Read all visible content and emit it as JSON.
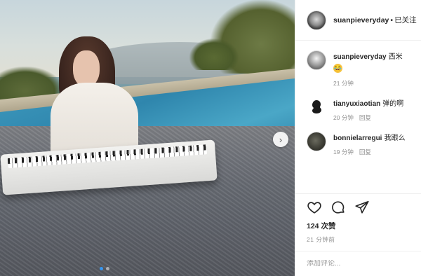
{
  "header": {
    "username": "suanpieveryday",
    "separator": "•",
    "follow_status": "已关注"
  },
  "comments": [
    {
      "username": "suanpieveryday",
      "text": "西米",
      "emoji": "😂",
      "time": "21 分钟",
      "reply": ""
    },
    {
      "username": "tianyuxiaotian",
      "text": "弹的啊",
      "time": "20 分钟",
      "reply": "回复"
    },
    {
      "username": "bonnielarregui",
      "text": "我跟么",
      "time": "19 分钟",
      "reply": "回复"
    }
  ],
  "actions": {
    "like_icon": "heart-icon",
    "comment_icon": "comment-icon",
    "share_icon": "share-icon"
  },
  "likes": "124 次赞",
  "post_time": "21 分钟前",
  "add_comment": {
    "placeholder": "添加评论..."
  },
  "media": {
    "next_arrow": "›",
    "dot_count": 2,
    "active_dot": 0
  },
  "colors": {
    "link_blue": "#3897f0",
    "meta_gray": "#8e8e8e",
    "text": "#262626"
  }
}
